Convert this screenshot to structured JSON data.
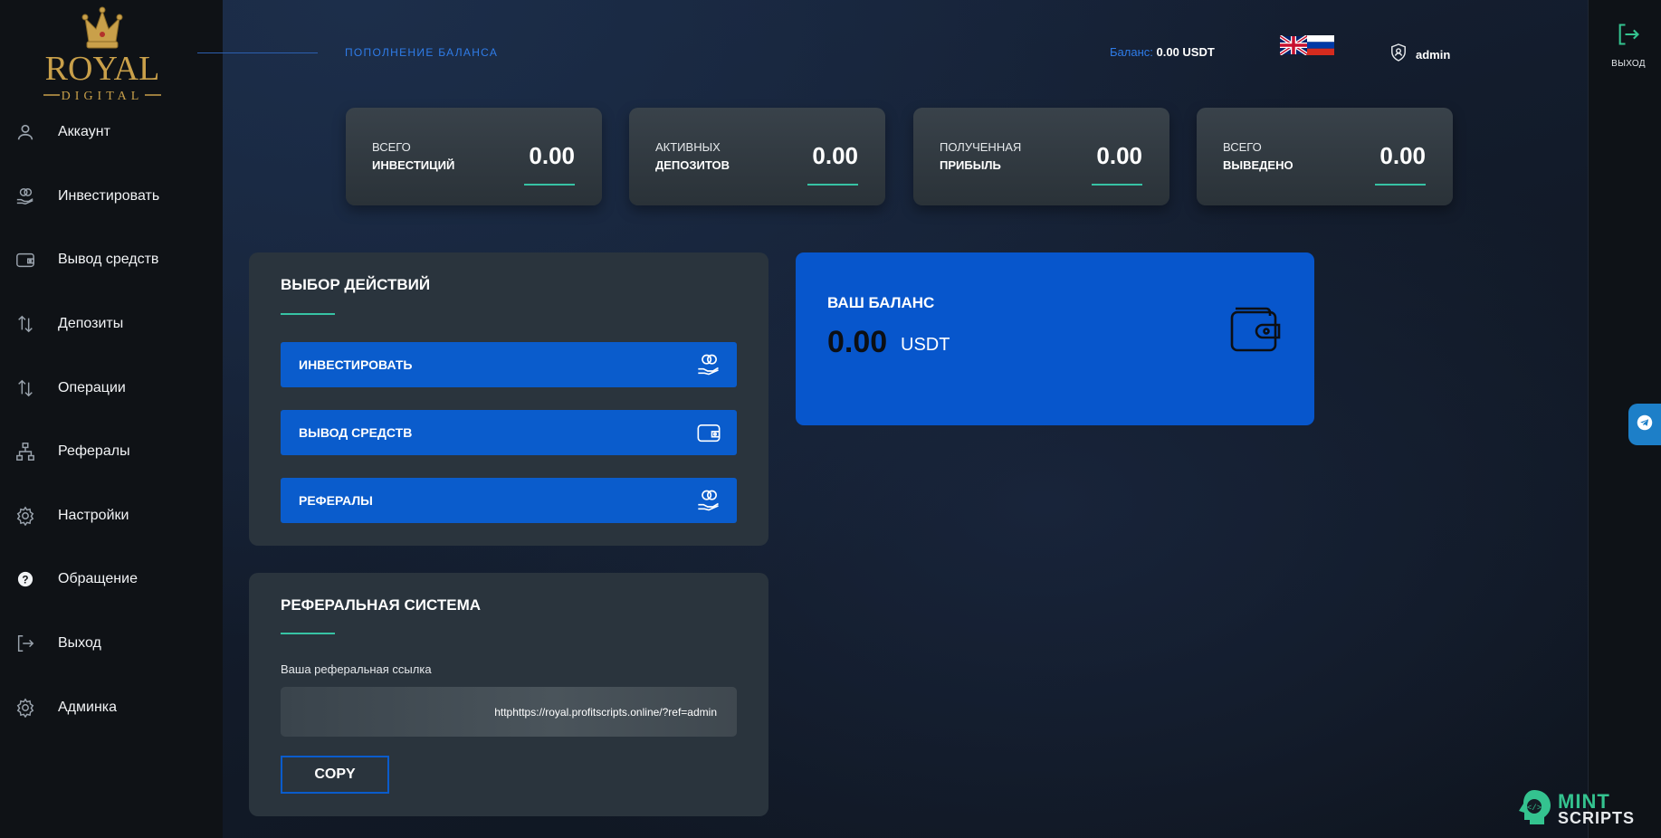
{
  "logo": {
    "brand": "ROYAL",
    "sub": "DIGITAL"
  },
  "sidebar": {
    "items": [
      {
        "label": "Аккаунт",
        "icon": "user-icon"
      },
      {
        "label": "Инвестировать",
        "icon": "coins-hand-icon"
      },
      {
        "label": "Вывод средств",
        "icon": "wallet-icon"
      },
      {
        "label": "Депозиты",
        "icon": "arrows-updown-icon"
      },
      {
        "label": "Операции",
        "icon": "arrows-updown-icon"
      },
      {
        "label": "Рефералы",
        "icon": "hierarchy-icon"
      },
      {
        "label": "Настройки",
        "icon": "gear-icon"
      },
      {
        "label": "Обращение",
        "icon": "question-icon"
      },
      {
        "label": "Выход",
        "icon": "logout-icon"
      },
      {
        "label": "Админка",
        "icon": "gear-icon"
      }
    ]
  },
  "header": {
    "title": "ПОПОЛНЕНИЕ БАЛАНСА",
    "balance_label": "Баланс:",
    "balance_value": "0.00 USDT",
    "user": "admin"
  },
  "rail": {
    "exit_label": "ВЫХОД"
  },
  "stats": [
    {
      "line1": "ВСЕГО",
      "line2": "ИНВЕСТИЦИЙ",
      "value": "0.00"
    },
    {
      "line1": "АКТИВНЫХ",
      "line2": "ДЕПОЗИТОВ",
      "value": "0.00"
    },
    {
      "line1": "ПОЛУЧЕННАЯ",
      "line2": "ПРИБЫЛЬ",
      "value": "0.00"
    },
    {
      "line1": "ВСЕГО",
      "line2": "ВЫВЕДЕНО",
      "value": "0.00"
    }
  ],
  "actions": {
    "title": "ВЫБОР ДЕЙСТВИЙ",
    "buttons": [
      {
        "label": "ИНВЕСТИРОВАТЬ"
      },
      {
        "label": "ВЫВОД СРЕДСТВ"
      },
      {
        "label": "РЕФЕРАЛЫ"
      }
    ]
  },
  "referral": {
    "title": "РЕФЕРАЛЬНАЯ СИСТЕМА",
    "label": "Ваша реферальная ссылка",
    "link": "httphttps://royal.profitscripts.online/?ref=admin",
    "copy_label": "COPY"
  },
  "balance_card": {
    "title": "ВАШ БАЛАНС",
    "amount": "0.00",
    "currency": "USDT"
  },
  "watermark": {
    "line1": "MINT",
    "line2": "SCRIPTS"
  },
  "colors": {
    "accent_blue": "#0a5ccc",
    "underline_teal": "#37c3a4",
    "header_blue": "#2f7ce8"
  }
}
